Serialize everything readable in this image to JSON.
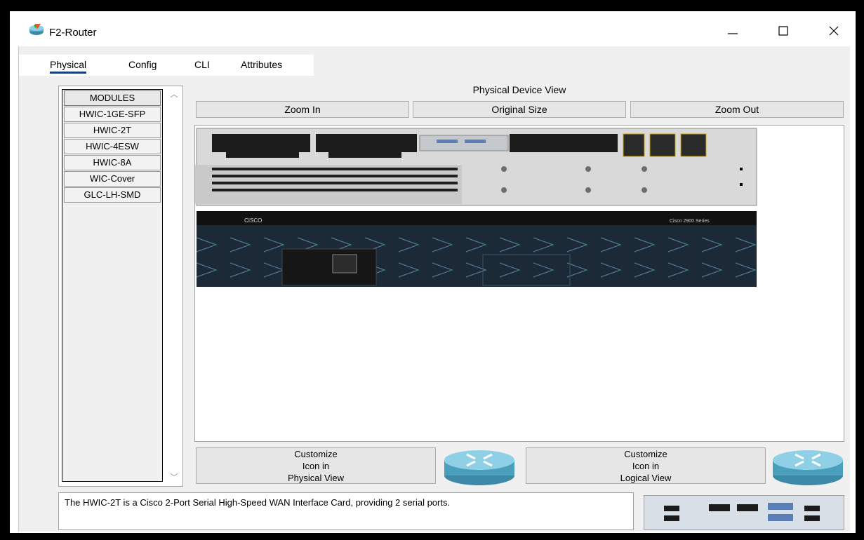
{
  "window": {
    "title": "F2-Router",
    "controls": {
      "minimize": "—",
      "maximize": "☐",
      "close": "✕"
    }
  },
  "tabs": [
    {
      "label": "Physical",
      "active": true
    },
    {
      "label": "Config",
      "active": false
    },
    {
      "label": "CLI",
      "active": false
    },
    {
      "label": "Attributes",
      "active": false
    }
  ],
  "modules": {
    "items": [
      "MODULES",
      "HWIC-1GE-SFP",
      "HWIC-2T",
      "HWIC-4ESW",
      "HWIC-8A",
      "WIC-Cover",
      "GLC-LH-SMD"
    ]
  },
  "physical_view": {
    "label": "Physical Device View",
    "zoom_in": "Zoom In",
    "original_size": "Original Size",
    "zoom_out": "Zoom Out",
    "chassis_brand": "CISCO",
    "chassis_series": "Cisco 2900 Series"
  },
  "customize": {
    "physical": {
      "line1": "Customize",
      "line2": "Icon in",
      "line3": "Physical View"
    },
    "logical": {
      "line1": "Customize",
      "line2": "Icon in",
      "line3": "Logical View"
    }
  },
  "description": "The HWIC-2T is a Cisco 2-Port Serial High-Speed WAN Interface Card, providing 2 serial ports.",
  "colors": {
    "accent": "#1a3f7a",
    "chassis": "#1b2a36",
    "router_icon": "#4a9fbd"
  }
}
